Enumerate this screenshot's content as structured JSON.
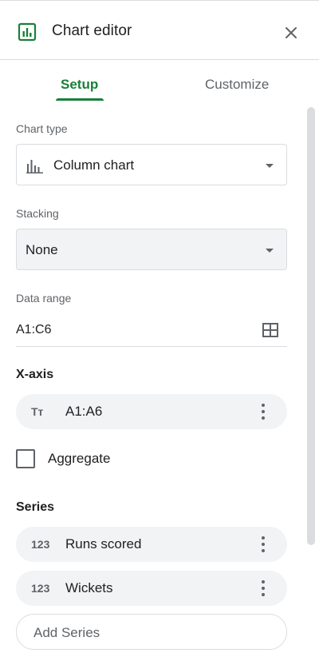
{
  "header": {
    "title": "Chart editor",
    "chart_icon": "bar-chart-icon",
    "close_icon": "close-icon",
    "accent_color": "#188038"
  },
  "tabs": [
    {
      "label": "Setup",
      "active": true
    },
    {
      "label": "Customize",
      "active": false
    }
  ],
  "setup": {
    "chart_type": {
      "label": "Chart type",
      "value": "Column chart",
      "icon": "column-chart-icon"
    },
    "stacking": {
      "label": "Stacking",
      "value": "None"
    },
    "data_range": {
      "label": "Data range",
      "value": "A1:C6",
      "icon": "grid-icon"
    },
    "x_axis": {
      "title": "X-axis",
      "chip": {
        "icon_text": "Tт",
        "label": "A1:A6",
        "icon": "text-type-icon"
      },
      "aggregate": {
        "label": "Aggregate",
        "checked": false
      }
    },
    "series": {
      "title": "Series",
      "items": [
        {
          "icon_text": "123",
          "label": "Runs scored"
        },
        {
          "icon_text": "123",
          "label": "Wickets"
        }
      ],
      "add_placeholder": "Add Series"
    }
  }
}
